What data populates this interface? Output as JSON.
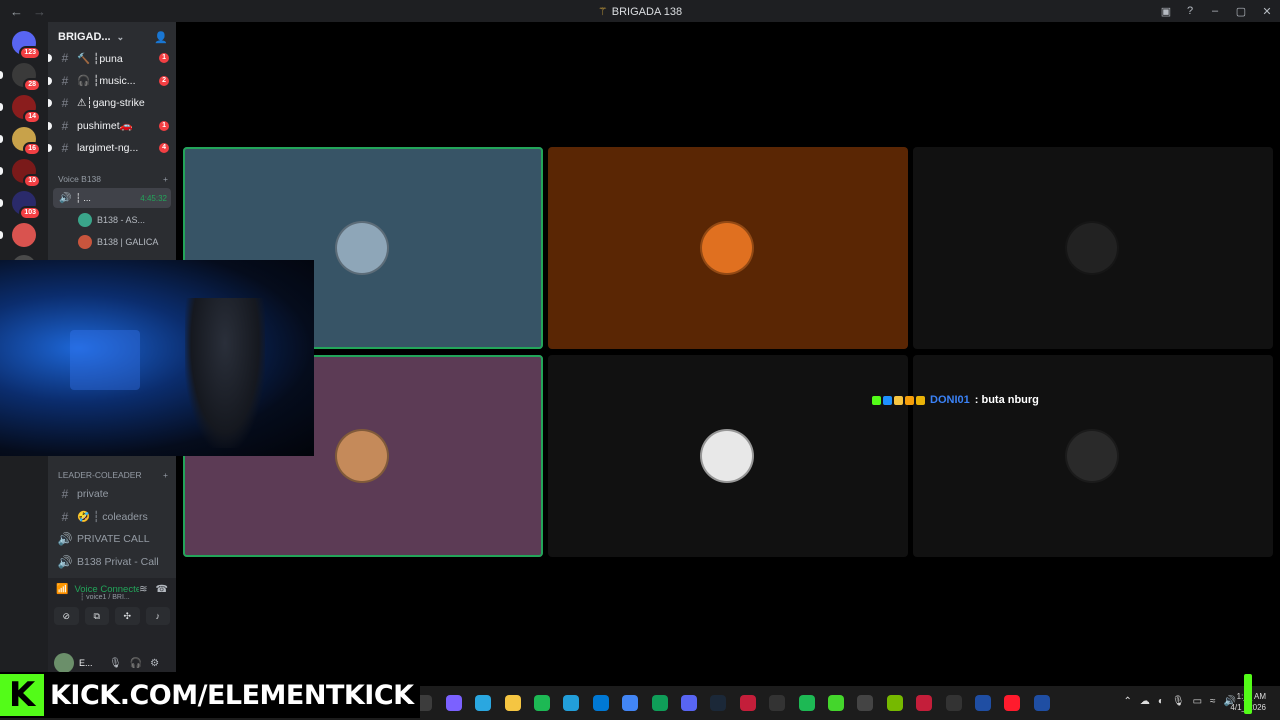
{
  "window": {
    "title": "BRIGADA 138",
    "back_icon": "←",
    "forward_icon": "→"
  },
  "server_rail": [
    {
      "badge": "123",
      "color": "#5865f2"
    },
    {
      "badge": "28",
      "color": "#3a3a3a"
    },
    {
      "badge": "14",
      "color": "#8a1d1d"
    },
    {
      "badge": "16",
      "color": "#c8a24a"
    },
    {
      "badge": "10",
      "color": "#7a1a1a"
    },
    {
      "badge": "103",
      "color": "#2a2a6a"
    },
    {
      "badge": "",
      "color": "#d9534f"
    },
    {
      "badge": "342",
      "color": "#4a4a4a"
    },
    {
      "badge": "3",
      "color": "#c8a24a"
    },
    {
      "badge": "12",
      "color": "#b01e1e"
    },
    {
      "badge": "NEW",
      "color": "#1e90ff"
    }
  ],
  "server": {
    "name": "BRIGAD...",
    "channels": [
      {
        "name": "🔨 ┆puna",
        "count": "1"
      },
      {
        "name": "🎧 ┆music...",
        "count": "2"
      },
      {
        "name": "⚠┆gang-strike",
        "count": ""
      },
      {
        "name": "pushimet🚗",
        "count": "1"
      },
      {
        "name": "largimet-ng...",
        "count": "4"
      }
    ],
    "voice_category": "Voice B138",
    "active_voice": {
      "name": "┆ ...",
      "time": "4:45:32"
    },
    "voice_users": [
      {
        "name": "B138 - AS...",
        "color": "#3aa58a"
      },
      {
        "name": "B138 | GALICA",
        "color": "#c8553d"
      }
    ],
    "leader_category": "LEADER-COLEADER",
    "leader_channels": [
      {
        "name": "private",
        "icon": "#"
      },
      {
        "name": "🤣 ┆ coleaders",
        "icon": "#"
      },
      {
        "name": "PRIVATE CALL",
        "icon": "🔊"
      },
      {
        "name": "B138 Privat - Call",
        "icon": "🔊"
      }
    ]
  },
  "voice_panel": {
    "status": "Voice Connected",
    "sub": "┆ voice1 / BRI...",
    "buttons": [
      "camera-off",
      "screen-share",
      "activities",
      "soundboard"
    ]
  },
  "user_panel": {
    "name": "E..."
  },
  "video_tiles": [
    {
      "bg": "#375466",
      "speaking": true,
      "avatar": "#8ea6b8"
    },
    {
      "bg": "#5a2604",
      "speaking": false,
      "avatar": "#e07020"
    },
    {
      "bg": "#111111",
      "speaking": false,
      "avatar": "#222222"
    },
    {
      "bg": "#5c3b55",
      "speaking": true,
      "avatar": "#c58a5a"
    },
    {
      "bg": "#111111",
      "speaking": false,
      "avatar": "#e8e8e8"
    },
    {
      "bg": "#111111",
      "speaking": false,
      "avatar": "#2a2a2a"
    }
  ],
  "chat_overlay": {
    "username": "DONI01",
    "message": ": buta nburg"
  },
  "taskbar": {
    "apps": [
      "#f2b400",
      "#3c3c3c",
      "#7b61ff",
      "#2aa7e0",
      "#f5c542",
      "#1db954",
      "#229ed9",
      "#0078d4",
      "#4285f4",
      "#0f9d58",
      "#5865f2",
      "#1b2838",
      "#c41e3a",
      "#333333",
      "#1db954",
      "#44d62c",
      "#444444",
      "#76b900",
      "#c41e3a",
      "#333333",
      "#1f4ea3",
      "#ff1b2d",
      "#1f4ea3"
    ],
    "clock_time": "1:__ AM",
    "clock_date": "4/1_/2026"
  },
  "stream_banner": {
    "logo": "K",
    "text": "KICK.COM/ELEMENTKICK"
  }
}
